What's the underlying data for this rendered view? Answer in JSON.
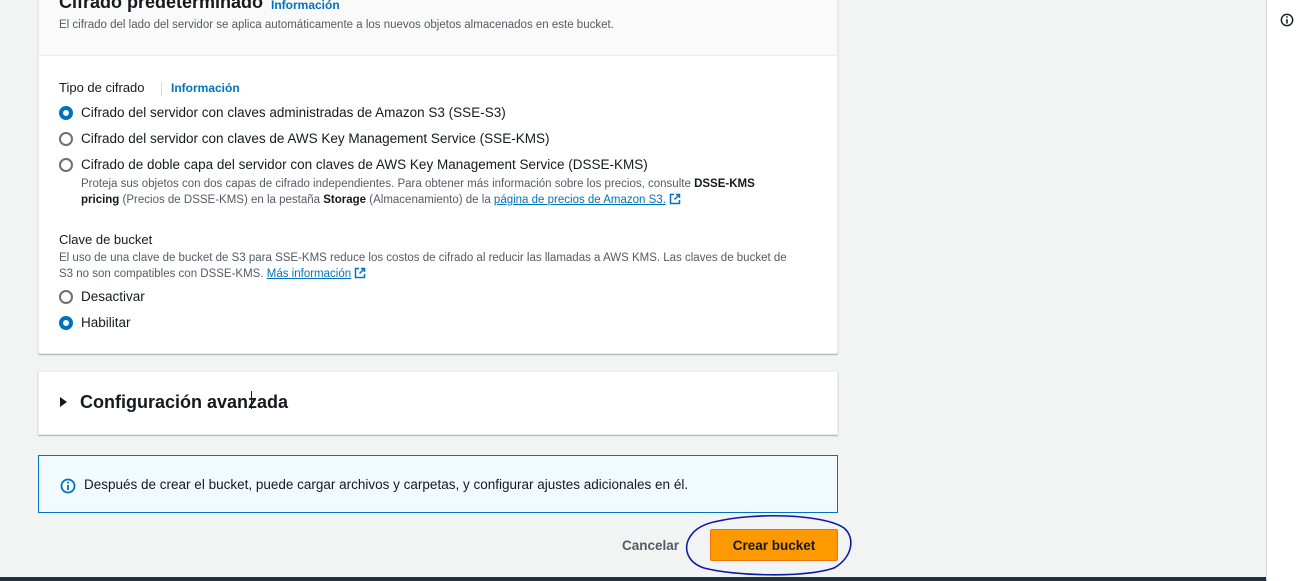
{
  "encryption": {
    "title": "Cifrado predeterminado",
    "title_info": "Información",
    "description": "El cifrado del lado del servidor se aplica automáticamente a los nuevos objetos almacenados en este bucket.",
    "type_label": "Tipo de cifrado",
    "type_info": "Información",
    "options": [
      {
        "label": "Cifrado del servidor con claves administradas de Amazon S3 (SSE-S3)",
        "checked": true
      },
      {
        "label": "Cifrado del servidor con claves de AWS Key Management Service (SSE-KMS)",
        "checked": false
      },
      {
        "label": "Cifrado de doble capa del servidor con claves de AWS Key Management Service (DSSE-KMS)",
        "checked": false
      }
    ],
    "dsse_help": {
      "line1_a": "Proteja sus objetos con dos capas de cifrado independientes. Para obtener más información sobre los precios, consulte ",
      "line1_b": "DSSE-KMS",
      "line2_a": "pricing",
      "line2_b": " (Precios de DSSE-KMS) en la pestaña ",
      "line2_c": "Storage",
      "line2_d": " (Almacenamiento) de la ",
      "line2_link": "página de precios de Amazon S3."
    }
  },
  "bucket_key": {
    "label": "Clave de bucket",
    "help_line1": "El uso de una clave de bucket de S3 para SSE-KMS reduce los costos de cifrado al reducir las llamadas a AWS KMS. Las claves de bucket de",
    "help_line2": "S3 no son compatibles con DSSE-KMS. ",
    "help_link": "Más información",
    "options": [
      {
        "label": "Desactivar",
        "checked": false
      },
      {
        "label": "Habilitar",
        "checked": true
      }
    ]
  },
  "advanced": {
    "title": "Configuración avanzada"
  },
  "alert": {
    "text": "Después de crear el bucket, puede cargar archivos y carpetas, y configurar ajustes adicionales en él."
  },
  "actions": {
    "cancel": "Cancelar",
    "create": "Crear bucket"
  },
  "colors": {
    "primary_button": "#ff9900",
    "link": "#0073bb",
    "annotation": "#0a1aa8"
  },
  "icons": {
    "info": "info-circle-icon",
    "external": "external-link-icon",
    "caret": "caret-right-icon"
  }
}
